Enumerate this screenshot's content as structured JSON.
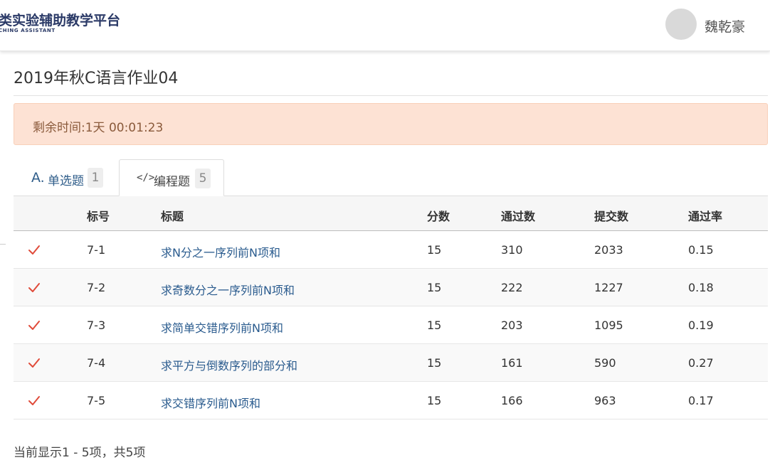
{
  "header": {
    "logo_title": "类实验辅助教学平台",
    "logo_subtitle": "CHING ASSISTANT",
    "username": "魏乾豪"
  },
  "page": {
    "title": "2019年秋C语言作业04",
    "countdown": "剩余时间:1天 00:01:23"
  },
  "tabs": [
    {
      "icon": "A.",
      "label": "单选题",
      "count": "1",
      "active": false
    },
    {
      "icon": "</>",
      "label": "编程题",
      "count": "5",
      "active": true
    }
  ],
  "table": {
    "headers": [
      "标号",
      "标题",
      "分数",
      "通过数",
      "提交数",
      "通过率"
    ],
    "rows": [
      {
        "status": "passed",
        "num": "7-1",
        "title": "求N分之一序列前N项和",
        "score": "15",
        "passed": "310",
        "submitted": "2033",
        "rate": "0.15"
      },
      {
        "status": "passed",
        "num": "7-2",
        "title": "求奇数分之一序列前N项和",
        "score": "15",
        "passed": "222",
        "submitted": "1227",
        "rate": "0.18"
      },
      {
        "status": "passed",
        "num": "7-3",
        "title": "求简单交错序列前N项和",
        "score": "15",
        "passed": "203",
        "submitted": "1095",
        "rate": "0.19"
      },
      {
        "status": "passed",
        "num": "7-4",
        "title": "求平方与倒数序列的部分和",
        "score": "15",
        "passed": "161",
        "submitted": "590",
        "rate": "0.27"
      },
      {
        "status": "passed",
        "num": "7-5",
        "title": "求交错序列前N项和",
        "score": "15",
        "passed": "166",
        "submitted": "963",
        "rate": "0.17"
      }
    ]
  },
  "footer": {
    "info": "当前显示1 - 5项，共5项"
  },
  "colors": {
    "check": "#e04b3a",
    "link": "#2a5b8e",
    "banner_bg": "#fde2d4",
    "banner_text": "#8a5a3b"
  }
}
